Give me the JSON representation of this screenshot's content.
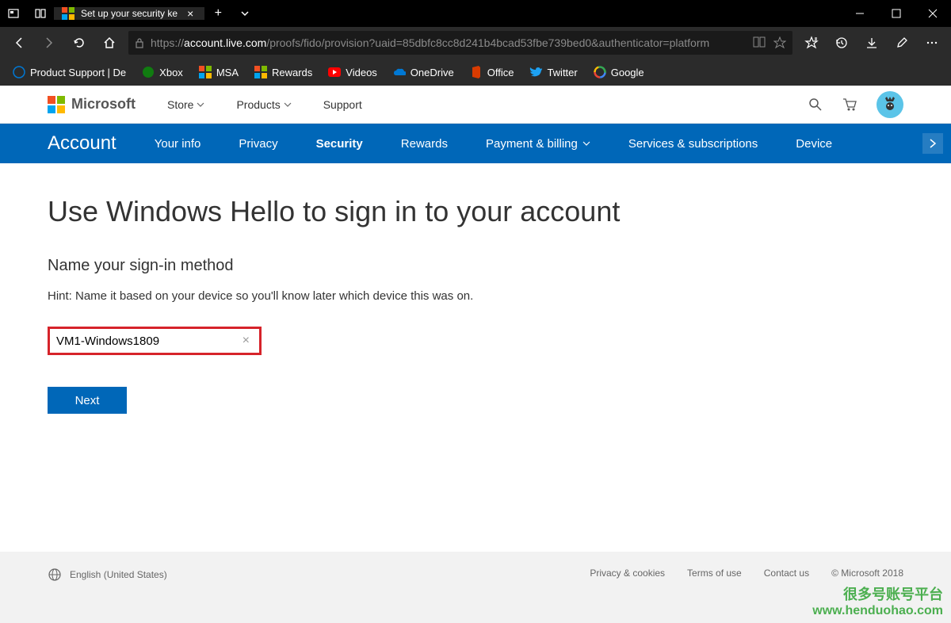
{
  "titlebar": {
    "tab_title": "Set up your security ke",
    "new_tab": "+"
  },
  "address": {
    "url_prefix": "https://",
    "url_host": "account.live.com",
    "url_path": "/proofs/fido/provision?uaid=85dbfc8cc8d241b4bcad53fbe739bed0&authenticator=platform"
  },
  "bookmarks": [
    {
      "label": "Product Support | De",
      "color": "#0078d4"
    },
    {
      "label": "Xbox",
      "color": "#107c10"
    },
    {
      "label": "MSA",
      "color": "ms"
    },
    {
      "label": "Rewards",
      "color": "ms"
    },
    {
      "label": "Videos",
      "color": "#ff0000"
    },
    {
      "label": "OneDrive",
      "color": "#0078d4"
    },
    {
      "label": "Office",
      "color": "#d83b01"
    },
    {
      "label": "Twitter",
      "color": "#1da1f2"
    },
    {
      "label": "Google",
      "color": "g"
    }
  ],
  "header": {
    "brand": "Microsoft",
    "nav": [
      "Store",
      "Products",
      "Support"
    ]
  },
  "blueNav": {
    "brand": "Account",
    "items": [
      "Your info",
      "Privacy",
      "Security",
      "Rewards",
      "Payment & billing",
      "Services & subscriptions",
      "Device"
    ],
    "active": "Security"
  },
  "content": {
    "title": "Use Windows Hello to sign in to your account",
    "section": "Name your sign-in method",
    "hint": "Hint: Name it based on your device so you'll know later which device this was on.",
    "input_value": "VM1-Windows1809",
    "next": "Next"
  },
  "footer": {
    "locale": "English (United States)",
    "links": [
      "Privacy & cookies",
      "Terms of use",
      "Contact us"
    ],
    "copyright": "© Microsoft 2018"
  },
  "watermark": {
    "line1": "很多号账号平台",
    "line2": "www.henduohao.com"
  }
}
